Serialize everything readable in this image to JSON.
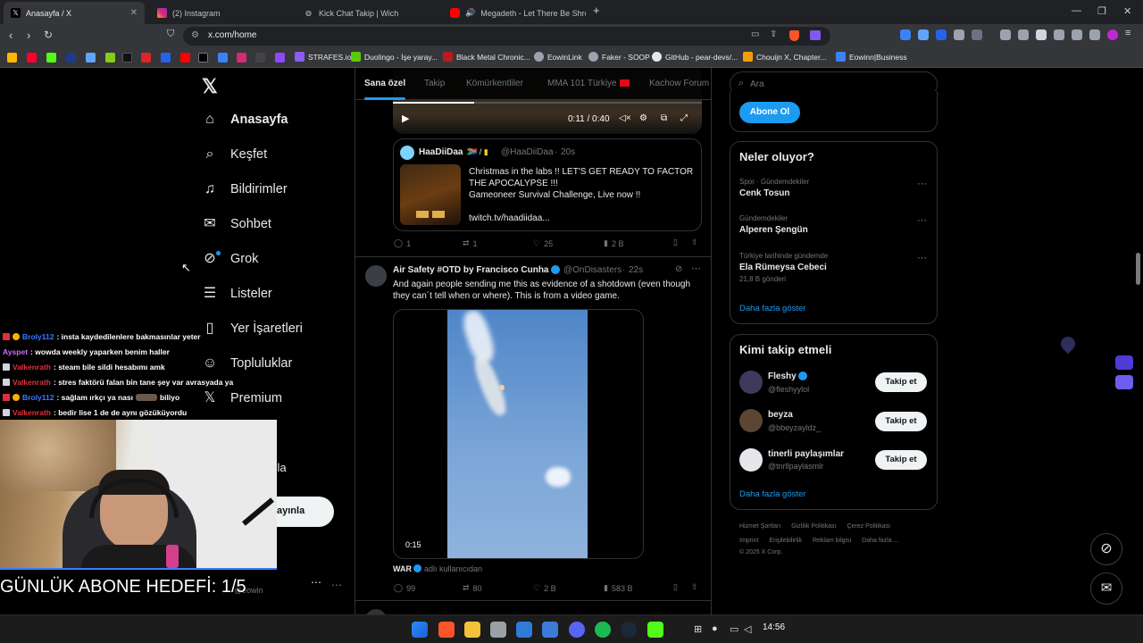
{
  "browser": {
    "tabs": [
      {
        "title": "Anasayfa / X",
        "active": true,
        "icon": "x-logo-icon"
      },
      {
        "title": "(2) Instagram",
        "icon": "instagram-icon"
      },
      {
        "title": "Kick Chat Takip | Wich",
        "icon": "globe-icon"
      },
      {
        "title": "Megadeth - Let There Be Shred (",
        "icon": "youtube-icon",
        "audio": true
      }
    ],
    "url": "x.com/home",
    "bookmarks": [
      "STRAFES.io",
      "Duolingo - İşe yaray...",
      "Black Metal Chronic...",
      "EowinLink",
      "Faker - SOOP",
      "GitHub - pear-devs/...",
      "Chouijn X, Chapter...",
      "Eowinn|Business"
    ]
  },
  "nav": {
    "items": [
      {
        "label": "Anasayfa",
        "icon": "home-icon"
      },
      {
        "label": "Keşfet",
        "icon": "search-icon"
      },
      {
        "label": "Bildirimler",
        "icon": "bell-icon"
      },
      {
        "label": "Sohbet",
        "icon": "mail-icon"
      },
      {
        "label": "Grok",
        "icon": "grok-icon"
      },
      {
        "label": "Listeler",
        "icon": "list-icon"
      },
      {
        "label": "Yer İşaretleri",
        "icon": "bookmark-icon"
      },
      {
        "label": "Topluluklar",
        "icon": "people-icon"
      },
      {
        "label": "Premium",
        "icon": "x-logo-icon"
      }
    ],
    "partial_more": "zla",
    "post_button_partial": "ayınla",
    "account_partial": "@eowin"
  },
  "feed": {
    "tabs": [
      "Sana özel",
      "Takip",
      "Kömürkentliler",
      "MMA 101 Türkiye",
      "Kachow Forum"
    ],
    "video_time": "0:11 / 0:40",
    "quote": {
      "name": "HaaDiiDaa",
      "handle": "@HaaDiiDaa",
      "time": "20s",
      "text_lines": [
        "Christmas in the labs !! LET'S GET READY TO FACTOR",
        "THE APOCALYPSE !!!",
        "Gameoneer Survival Challenge, Live now !!"
      ],
      "link": "twitch.tv/haadiidaa..."
    },
    "post1_stats": {
      "replies": "1",
      "reposts": "1",
      "likes": "25",
      "views": "2 B"
    },
    "post2": {
      "name": "Air Safety #OTD by Francisco Cunha",
      "handle": "@OnDisasters",
      "time": "22s",
      "text_lines": [
        "And again people sending me this as evidence of a shotdown (even though",
        "they can´t tell when or where). This is from a video game."
      ],
      "video_time": "0:15",
      "attribution_name": "WAR",
      "attribution_suffix": "adlı kullanıcıdan",
      "stats": {
        "replies": "99",
        "reposts": "80",
        "likes": "2 B",
        "views": "583 B"
      }
    }
  },
  "right": {
    "search_placeholder": "Ara",
    "subscribe": "Abone Ol",
    "trends_title": "Neler oluyor?",
    "trends": [
      {
        "context": "Spor · Gündemdekiler",
        "name": "Cenk Tosun",
        "posts": ""
      },
      {
        "context": "Gündemdekiler",
        "name": "Alperen Şengün",
        "posts": ""
      },
      {
        "context": "Türkiye tarihinde gündemde",
        "name": "Ela Rümeysa Cebeci",
        "posts": "21,8 B gönderi"
      }
    ],
    "show_more": "Daha fazla göster",
    "follow_title": "Kimi takip etmeli",
    "follow": [
      {
        "name": "Fleshy",
        "handle": "@fleshyylol",
        "verified": true
      },
      {
        "name": "beyza",
        "handle": "@bbeyzayldz_",
        "verified": false
      },
      {
        "name": "tinerli paylaşımlar",
        "handle": "@tnrllpaylasmlr",
        "verified": false
      }
    ],
    "follow_button": "Takip et",
    "footer_line1": [
      "Hizmet Şartları",
      "Gizlilik Politikası",
      "Çerez Politikası"
    ],
    "footer_line2": [
      "Imprint",
      "Erişilebilirlik",
      "Reklam bilgisi",
      "Daha fazla ..."
    ],
    "copyright": "© 2025 X Corp."
  },
  "stream": {
    "chat": [
      {
        "user": "Broly112",
        "msg": ": insta kaydedilenlere bakmasınlar yeter",
        "color": "#3d7bff"
      },
      {
        "user": "Ayspet",
        "msg": ": wowda weekly yaparken benim haller",
        "color": "#c86cff"
      },
      {
        "user": "Valkenrath",
        "msg": ": steam bile sildi hesabımı amk",
        "color": "#e0303c"
      },
      {
        "user": "Valkenrath",
        "msg": ": stres faktörü falan bin tane şey var avrasyada ya",
        "color": "#e0303c"
      },
      {
        "user": "Broly112",
        "msg": ": sağlam ırkçı ya nası",
        "msg2": "biliyo",
        "color": "#3d7bff"
      },
      {
        "user": "Valkenrath",
        "msg": ": bedir lise 1 de de aynı gözüküyordu",
        "color": "#e0303c"
      }
    ],
    "goal": "GÜNLÜK ABONE HEDEFİ: 1/5"
  },
  "taskbar": {
    "time": "14:56"
  }
}
